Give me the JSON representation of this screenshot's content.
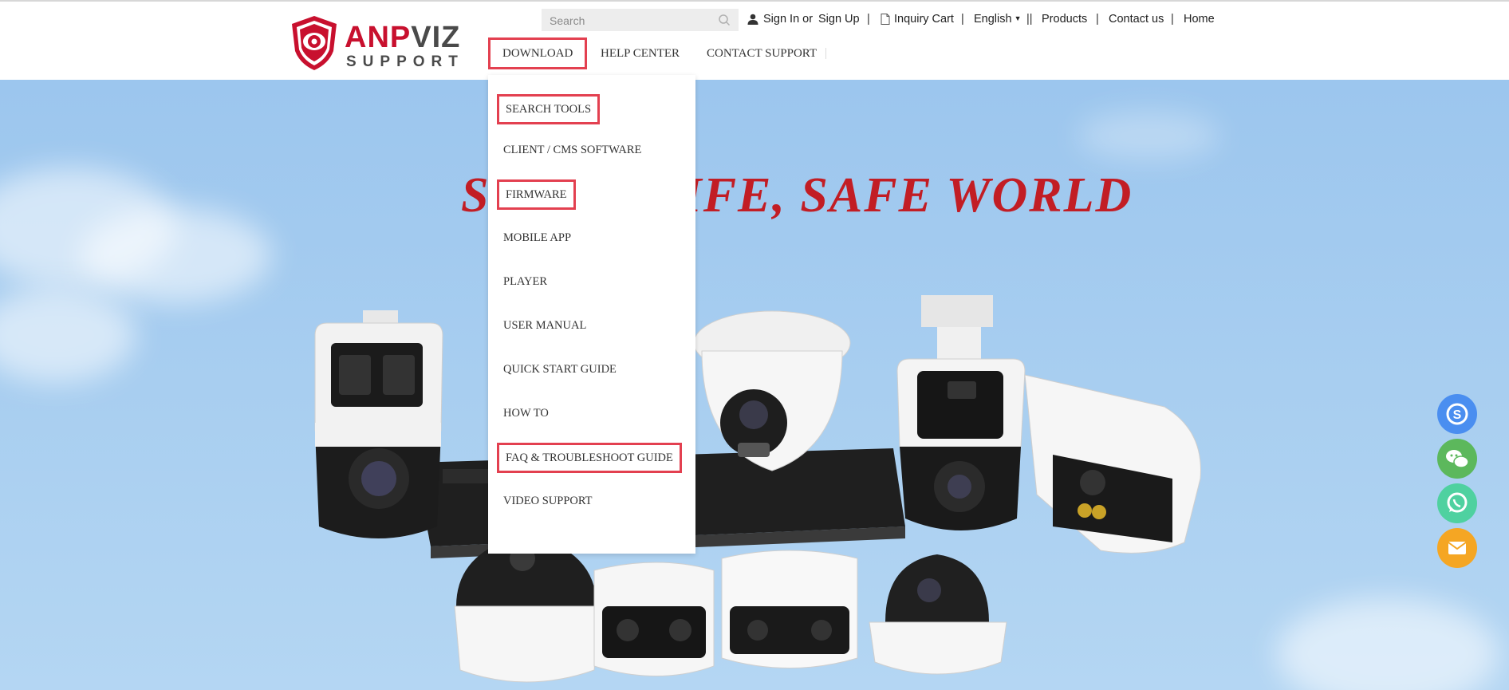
{
  "brand": {
    "name_part1": "ANP",
    "name_part2": "VIZ",
    "tagline": "SUPPORT"
  },
  "search": {
    "placeholder": "Search"
  },
  "top_links": {
    "sign_in": "Sign In or",
    "sign_up": "Sign Up",
    "inquiry_cart": "Inquiry Cart",
    "language": "English",
    "products": "Products",
    "contact_us": "Contact us",
    "home": "Home",
    "sep": "|",
    "double_sep": "||"
  },
  "main_nav": {
    "download": "DOWNLOAD",
    "help_center": "HELP CENTER",
    "contact_support": "CONTACT SUPPORT"
  },
  "dropdown": {
    "items": [
      "SEARCH TOOLS",
      "CLIENT / CMS SOFTWARE",
      "FIRMWARE",
      "MOBILE APP",
      "PLAYER",
      "USER MANUAL",
      "QUICK START GUIDE",
      "HOW TO",
      "FAQ & TROUBLESHOOT GUIDE",
      "VIDEO SUPPORT"
    ]
  },
  "hero": {
    "headline": "SMART LIFE, SAFE WORLD",
    "headline_visible": "S                   E, SAFE WORLD"
  },
  "floating": {
    "buttons": [
      "skype-icon",
      "wechat-icon",
      "whatsapp-icon",
      "mail-icon"
    ]
  },
  "colors": {
    "brand_red": "#c8102e",
    "highlight": "#e34050",
    "skype": "#4a8ef0",
    "wechat": "#5cb85c",
    "whatsapp": "#4fd1a0",
    "mail": "#f5a623"
  }
}
